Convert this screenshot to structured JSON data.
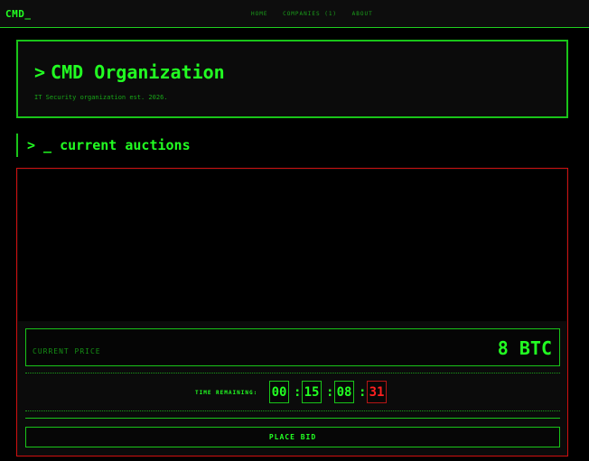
{
  "header": {
    "logo": "CMD_",
    "nav": [
      "HOME",
      "COMPANIES (1)",
      "ABOUT"
    ]
  },
  "hero": {
    "caret": ">",
    "title": "CMD Organization",
    "subtitle": "IT Security organization est. 2026."
  },
  "section": {
    "title": "> _ current auctions"
  },
  "auction": {
    "price_label": "CURRENT PRICE",
    "price_value": "8 BTC",
    "timer_label": "TIME REMAINING:",
    "timer": [
      "00",
      "15",
      "08",
      "31"
    ],
    "separator": ":",
    "bid_label": "PLACE BID"
  },
  "colors": {
    "accent": "#22ff22",
    "alert": "#ff2020",
    "background": "#000000"
  }
}
